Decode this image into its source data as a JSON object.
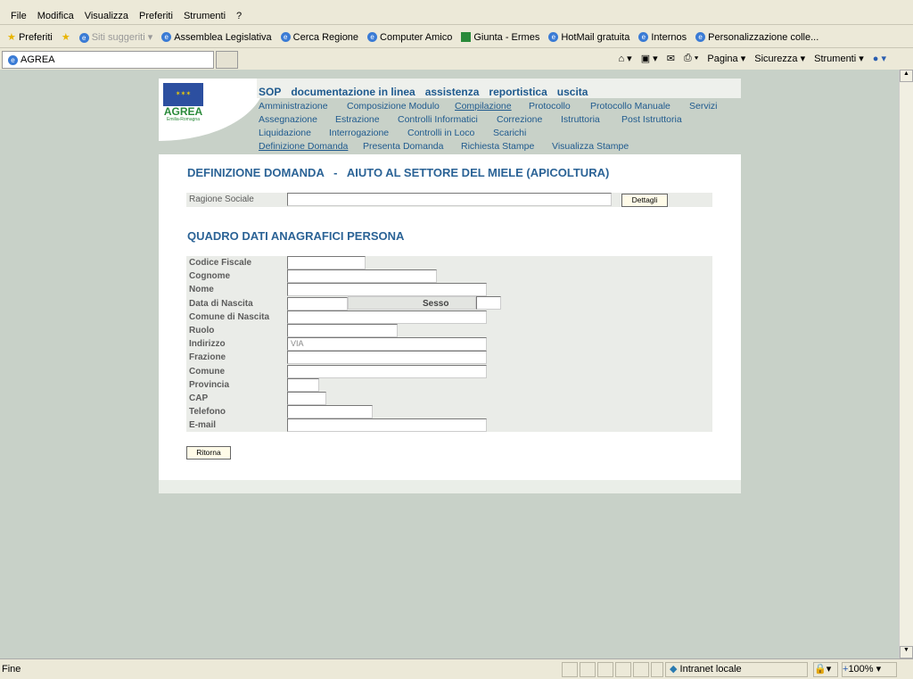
{
  "browser": {
    "menu": [
      "File",
      "Modifica",
      "Visualizza",
      "Preferiti",
      "Strumenti",
      "?"
    ],
    "favorites_label": "Preferiti",
    "favorites": [
      "Siti suggeriti ▾",
      "Assemblea Legislativa",
      "Cerca Regione",
      "Computer Amico",
      "Giunta - Ermes",
      "HotMail gratuita",
      "Internos",
      "Personalizzazione colle..."
    ],
    "tab_title": "AGREA",
    "tools": [
      "Pagina ▾",
      "Sicurezza ▾",
      "Strumenti ▾"
    ],
    "status_text": "Fine",
    "zone": "Intranet locale",
    "zoom": "100%"
  },
  "logo": {
    "text": "AGREA",
    "sub": "Emilia-Romagna"
  },
  "nav": {
    "top": [
      "SOP",
      "documentazione in linea",
      "assistenza",
      "reportistica",
      "uscita"
    ],
    "row1": [
      "Amministrazione",
      "Composizione Modulo",
      "Compilazione",
      "Protocollo",
      "Protocollo Manuale",
      "Servizi"
    ],
    "row2": [
      "Assegnazione",
      "Estrazione",
      "Controlli Informatici",
      "Correzione",
      "Istruttoria",
      "Post Istruttoria"
    ],
    "row3": [
      "Liquidazione",
      "Interrogazione",
      "Controlli in Loco",
      "Scarichi"
    ],
    "sub": [
      "Definizione Domanda",
      "Presenta Domanda",
      "Richiesta Stampe",
      "Visualizza Stampe"
    ]
  },
  "page": {
    "title": "DEFINIZIONE DOMANDA   -   AIUTO AL SETTORE DEL MIELE (APICOLTURA)",
    "ragione_label": "Ragione Sociale",
    "ragione_value": "",
    "dettagli": "Dettagli",
    "section": "QUADRO DATI ANAGRAFICI PERSONA",
    "fields": [
      {
        "label": "Codice Fiscale",
        "value": ""
      },
      {
        "label": "Cognome",
        "value": ""
      },
      {
        "label": "Nome",
        "value": ""
      },
      {
        "label": "Data di Nascita",
        "value": ""
      },
      {
        "label": "Comune di Nascita",
        "value": ""
      },
      {
        "label": "Ruolo",
        "value": ""
      },
      {
        "label": "Indirizzo",
        "value": "VIA"
      },
      {
        "label": "Frazione",
        "value": ""
      },
      {
        "label": "Comune",
        "value": ""
      },
      {
        "label": "Provincia",
        "value": ""
      },
      {
        "label": "CAP",
        "value": ""
      },
      {
        "label": "Telefono",
        "value": ""
      },
      {
        "label": "E-mail",
        "value": ""
      }
    ],
    "sesso_label": "Sesso",
    "sesso_value": "",
    "ritorna": "Ritorna"
  }
}
